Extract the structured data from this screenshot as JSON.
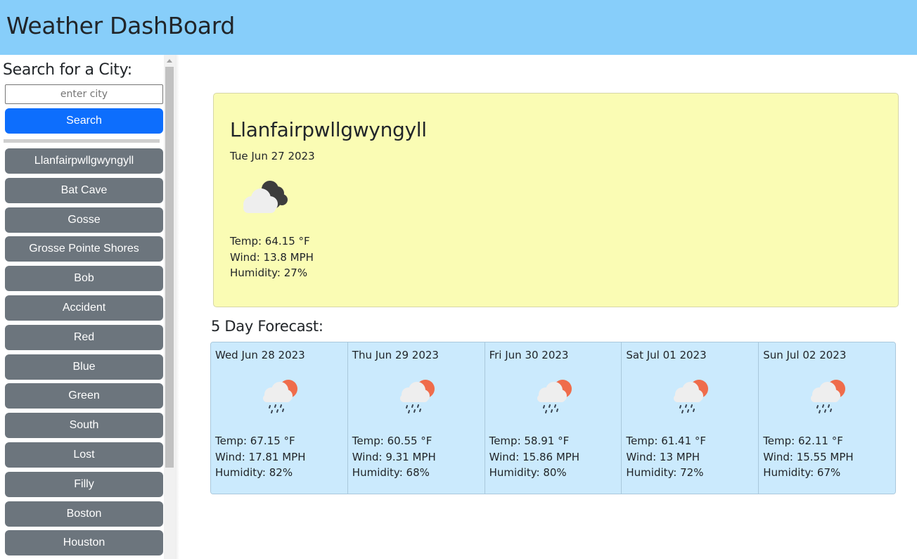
{
  "header": {
    "title": "Weather DashBoard"
  },
  "sidebar": {
    "search_label": "Search for a City:",
    "input_placeholder": "enter city",
    "input_value": "",
    "search_button": "Search",
    "history": [
      "Llanfairpwllgwyngyll",
      "Bat Cave",
      "Gosse",
      "Grosse Pointe Shores",
      "Bob",
      "Accident",
      "Red",
      "Blue",
      "Green",
      "South",
      "Lost",
      "Filly",
      "Boston",
      "Houston"
    ]
  },
  "current": {
    "city": "Llanfairpwllgwyngyll",
    "date": "Tue Jun 27 2023",
    "icon": "broken-clouds-icon",
    "temp": "Temp: 64.15 °F",
    "wind": "Wind: 13.8 MPH",
    "humidity": "Humidity: 27%"
  },
  "forecast": {
    "title": "5 Day Forecast:",
    "days": [
      {
        "date": "Wed Jun 28 2023",
        "icon": "rain-sun-icon",
        "temp": "Temp: 67.15 °F",
        "wind": "Wind: 17.81 MPH",
        "humidity": "Humidity: 82%"
      },
      {
        "date": "Thu Jun 29 2023",
        "icon": "rain-sun-icon",
        "temp": "Temp: 60.55 °F",
        "wind": "Wind: 9.31 MPH",
        "humidity": "Humidity: 68%"
      },
      {
        "date": "Fri Jun 30 2023",
        "icon": "rain-sun-icon",
        "temp": "Temp: 58.91 °F",
        "wind": "Wind: 15.86 MPH",
        "humidity": "Humidity: 80%"
      },
      {
        "date": "Sat Jul 01 2023",
        "icon": "rain-sun-icon",
        "temp": "Temp: 61.41 °F",
        "wind": "Wind: 13 MPH",
        "humidity": "Humidity: 72%"
      },
      {
        "date": "Sun Jul 02 2023",
        "icon": "rain-sun-icon",
        "temp": "Temp: 62.11 °F",
        "wind": "Wind: 15.55 MPH",
        "humidity": "Humidity: 67%"
      }
    ]
  },
  "colors": {
    "header_bg": "#87cefa",
    "search_button": "#0d6efd",
    "history_button": "#6c757d",
    "current_card_bg": "#fafcb4",
    "forecast_card_bg": "#cbeafd"
  }
}
